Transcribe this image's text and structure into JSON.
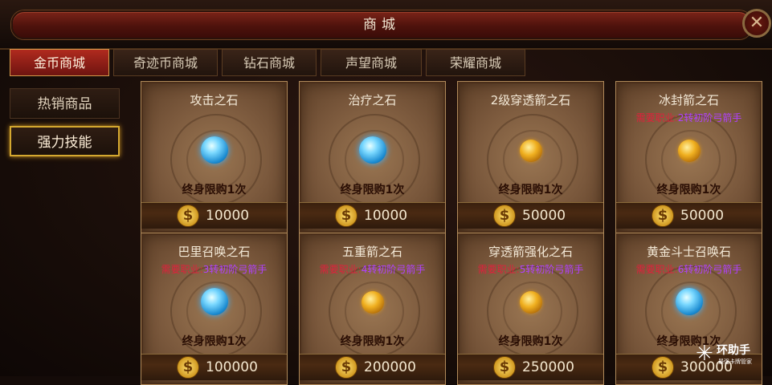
{
  "window": {
    "title": "商城",
    "close_icon": "close-icon"
  },
  "tabs": [
    {
      "label": "金币商城",
      "active": true
    },
    {
      "label": "奇迹币商城",
      "active": false
    },
    {
      "label": "钻石商城",
      "active": false
    },
    {
      "label": "声望商城",
      "active": false
    },
    {
      "label": "荣耀商城",
      "active": false
    }
  ],
  "side": [
    {
      "label": "热销商品",
      "active": false
    },
    {
      "label": "强力技能",
      "active": true
    }
  ],
  "items": [
    {
      "name": "攻击之石",
      "req_prefix": "",
      "req_level": "",
      "gem": "blue",
      "limit": "终身限购1次",
      "price": "10000"
    },
    {
      "name": "治疗之石",
      "req_prefix": "",
      "req_level": "",
      "gem": "blue",
      "limit": "终身限购1次",
      "price": "10000"
    },
    {
      "name": "2级穿透箭之石",
      "req_prefix": "",
      "req_level": "",
      "gem": "gold",
      "limit": "终身限购1次",
      "price": "50000"
    },
    {
      "name": "冰封箭之石",
      "req_prefix": "需要职业:",
      "req_level": "2转初阶弓箭手",
      "gem": "gold",
      "limit": "终身限购1次",
      "price": "50000"
    },
    {
      "name": "巴里召唤之石",
      "req_prefix": "需要职业:",
      "req_level": "3转初阶弓箭手",
      "gem": "blue",
      "limit": "终身限购1次",
      "price": "100000"
    },
    {
      "name": "五重箭之石",
      "req_prefix": "需要职业:",
      "req_level": "4转初阶弓箭手",
      "gem": "gold",
      "limit": "终身限购1次",
      "price": "200000"
    },
    {
      "name": "穿透箭强化之石",
      "req_prefix": "需要职业:",
      "req_level": "5转初阶弓箭手",
      "gem": "gold",
      "limit": "终身限购1次",
      "price": "250000"
    },
    {
      "name": "黄金斗士召唤石",
      "req_prefix": "需要职业:",
      "req_level": "6转初阶弓箭手",
      "gem": "blue",
      "limit": "终身限购1次",
      "price": "300000"
    }
  ],
  "currency_icon": "gold-coin-icon",
  "coin_symbol": "$",
  "watermark": {
    "text": "环助手",
    "sub": "最强卡牌管家"
  }
}
